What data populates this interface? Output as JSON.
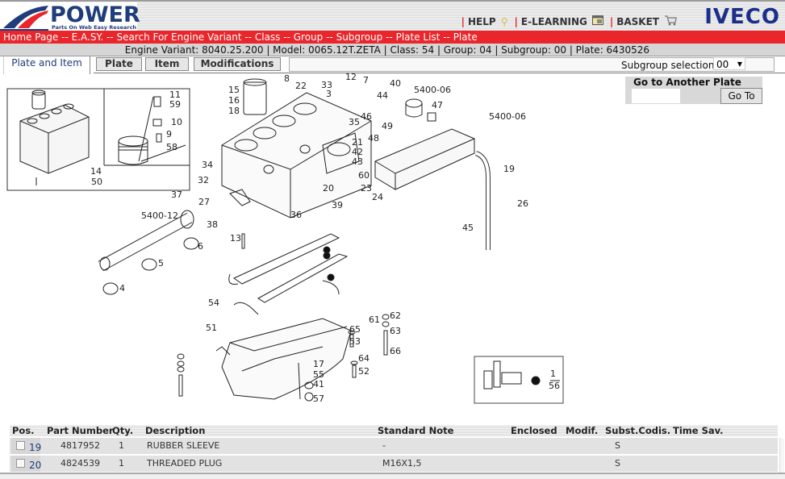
{
  "header": {
    "logo_title": "POWER",
    "logo_subtitle": "Parts On Web Easy Research",
    "links": [
      {
        "label": "HELP",
        "icon": "lightbulb-icon"
      },
      {
        "label": "E-LEARNING",
        "icon": "window-icon"
      },
      {
        "label": "BASKET",
        "icon": "cart-icon"
      }
    ],
    "brand": "IVECO"
  },
  "breadcrumb": [
    "Home Page",
    "E.A.SY.",
    "Search For Engine Variant",
    "Class",
    "Group",
    "Subgroup",
    "Plate List",
    "Plate"
  ],
  "breadcrumb_separator": " -- ",
  "info": {
    "text": "Engine Variant: 8040.25.200 | Model: 0065.12T.ZETA | Class: 54 | Group: 04 | Subgroup: 00 | Plate: 6430526"
  },
  "tabs": {
    "active": "Plate and Item",
    "buttons": [
      "Plate",
      "Item",
      "Modifications"
    ]
  },
  "subgroup": {
    "label": "Subgroup selection",
    "value": "00"
  },
  "goto": {
    "title": "Go to Another Plate",
    "input_value": "",
    "button": "Go To"
  },
  "diagram": {
    "labels": [
      "15",
      "16",
      "18",
      "8",
      "22",
      "33",
      "3",
      "12",
      "7",
      "40",
      "44",
      "5400-06",
      "47",
      "5400-06",
      "46",
      "49",
      "48",
      "35",
      "21",
      "42",
      "43",
      "60",
      "34",
      "32",
      "27",
      "20",
      "39",
      "23",
      "24",
      "36",
      "37",
      "38",
      "5400-12",
      "13",
      "6",
      "5",
      "4",
      "19",
      "26",
      "45",
      "11",
      "59",
      "10",
      "9",
      "58",
      "14",
      "50",
      "54",
      "51",
      "62",
      "61",
      "63",
      "66",
      "65",
      "53",
      "64",
      "52",
      "17",
      "55",
      "41",
      "57",
      "1",
      "56"
    ]
  },
  "table": {
    "columns": [
      "Pos.",
      "Part Number",
      "Qty.",
      "Description",
      "Standard Note",
      "Enclosed",
      "Modif.",
      "Subst.Codis.",
      "Time Sav."
    ],
    "rows": [
      {
        "pos": "19",
        "part_number": "4817952",
        "qty": "1",
        "description": "RUBBER SLEEVE",
        "standard_note": "-",
        "enclosed": "",
        "modif": "",
        "subst": "S",
        "time_sav": ""
      },
      {
        "pos": "20",
        "part_number": "4824539",
        "qty": "1",
        "description": "THREADED PLUG",
        "standard_note": "M16X1,5",
        "enclosed": "",
        "modif": "",
        "subst": "S",
        "time_sav": ""
      }
    ]
  },
  "colors": {
    "brand_red": "#e8262b",
    "brand_blue": "#1e3d7a",
    "iveco_blue": "#1a2f8a"
  }
}
